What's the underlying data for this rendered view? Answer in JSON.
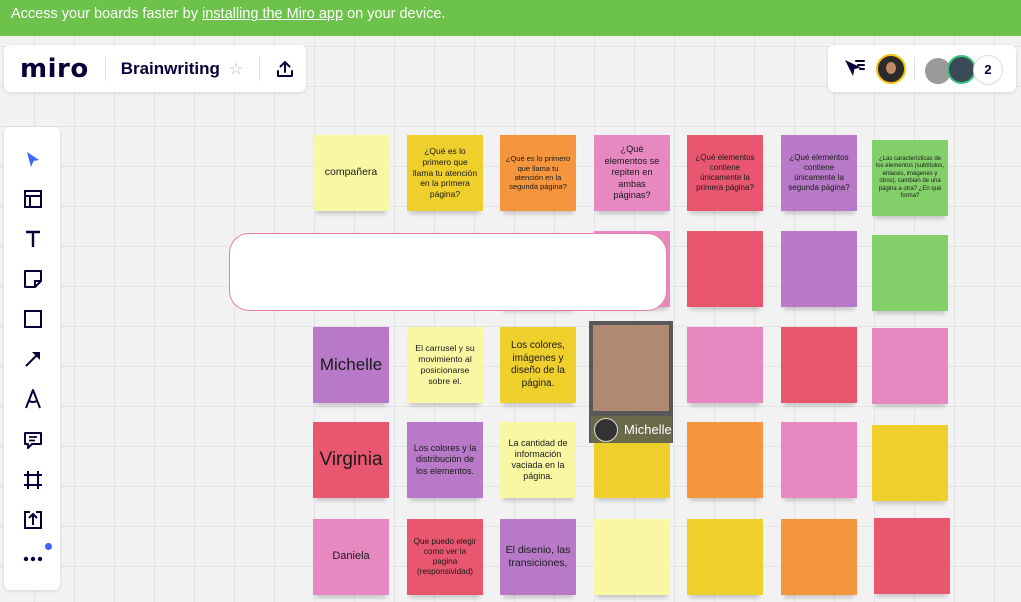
{
  "banner": {
    "prefix": "Access your boards faster by ",
    "link": "installing the Miro app",
    "suffix": " on your device."
  },
  "header": {
    "logo": "miro",
    "board_title": "Brainwriting",
    "star_icon": "star-icon",
    "share_icon": "upload-icon"
  },
  "collab": {
    "filter_icon": "cursor-filter-icon",
    "collaborator_count": "2"
  },
  "toolbar": {
    "tools": [
      "select-icon",
      "templates-icon",
      "text-icon",
      "sticky-note-icon",
      "shape-icon",
      "arrow-icon",
      "pen-icon",
      "comment-icon",
      "frame-icon",
      "upload-icon",
      "more-icon"
    ]
  },
  "colors": {
    "yellow": "#f9f7a3",
    "gold": "#eecf2c",
    "orange": "#f5963f",
    "pink": "#e888c0",
    "red": "#e8576f",
    "purple": "#b87ac8",
    "green": "#83d06a",
    "accent": "#4262ff",
    "banner": "#6cc24a"
  },
  "stickies": {
    "row1": [
      "compañera",
      "¿Qué es lo primero que llama tu atención en la primera página?",
      "¿Qué es lo primero que llama tu atención en la segunda página?",
      "¿Qué elementos se repiten en ambas páginas?",
      "¿Qué elementos contiene únicamente la primera página?",
      "¿Qué elementos contiene únicamente la segunda página?",
      "¿Las características de los elementos (subtítulos, enlaces, imágenes y otros), cambian de una página a otra? ¿En qué forma?"
    ],
    "row3": [
      "Michelle",
      "El carrusel y su movimiento al posicionarse sobre el.",
      "Los colores, imágenes y diseño de la página."
    ],
    "row4": [
      "Virginia",
      "Los colores y la distribución de los elementos.",
      "La cantidad de información vaciada en la página."
    ],
    "row5": [
      "Daniela",
      "Que puedo elegir como ver la pagina (responsividad)",
      "El disenio, las transiciones,"
    ]
  },
  "cursor": {
    "name": "Michelle"
  }
}
